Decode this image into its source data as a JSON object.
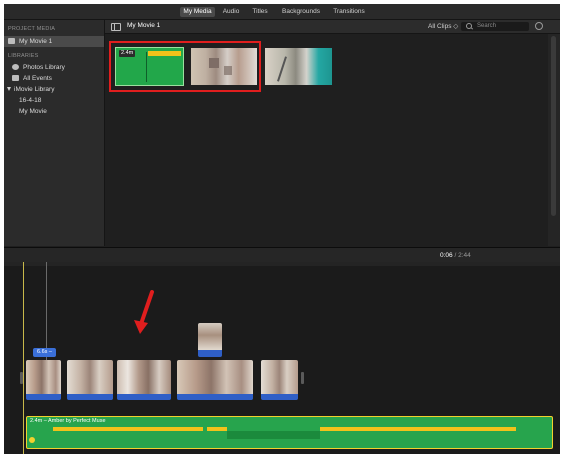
{
  "tabs": [
    {
      "label": "My Media",
      "active": true
    },
    {
      "label": "Audio",
      "active": false
    },
    {
      "label": "Titles",
      "active": false
    },
    {
      "label": "Backgrounds",
      "active": false
    },
    {
      "label": "Transitions",
      "active": false
    }
  ],
  "sidebar": {
    "project_media_header": "PROJECT MEDIA",
    "project_item": "My Movie 1",
    "libraries_header": "LIBRARIES",
    "items": [
      {
        "label": "Photos Library",
        "icon": "photos-icon"
      },
      {
        "label": "All Events",
        "icon": "events-icon"
      },
      {
        "label": "iMovie Library",
        "icon": "disclosure-triangle-icon"
      },
      {
        "label": "16-4-18",
        "icon": ""
      },
      {
        "label": "My Movie",
        "icon": ""
      }
    ]
  },
  "browser": {
    "project_title": "My Movie 1",
    "clips_filter": "All Clips ◇",
    "search_placeholder": "Search",
    "clip1_duration": "2.4m"
  },
  "timeline": {
    "current_time": "0:06",
    "separator": " / ",
    "total_time": "2:44",
    "title_chip": "6.6s –",
    "music_label": "2.4m – Amber by Perfect Muse"
  },
  "colors": {
    "accent_blue": "#3a6fd8",
    "music_green": "#27a44d",
    "selection_yellow": "#f2d12e",
    "highlight_red": "#e01e1e"
  }
}
